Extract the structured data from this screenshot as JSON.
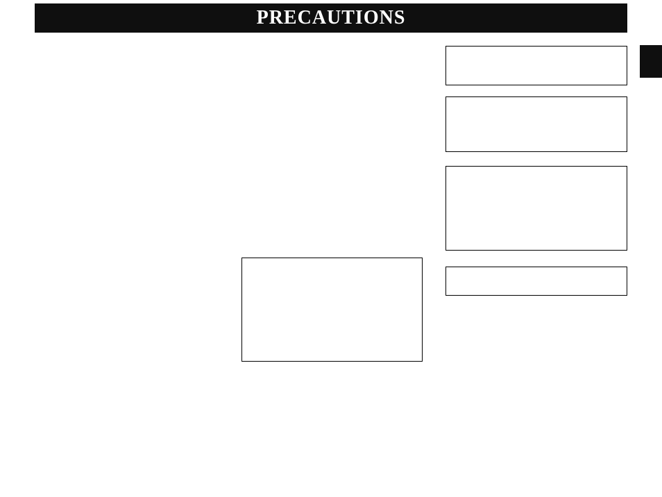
{
  "header": {
    "title": "PRECAUTIONS"
  }
}
